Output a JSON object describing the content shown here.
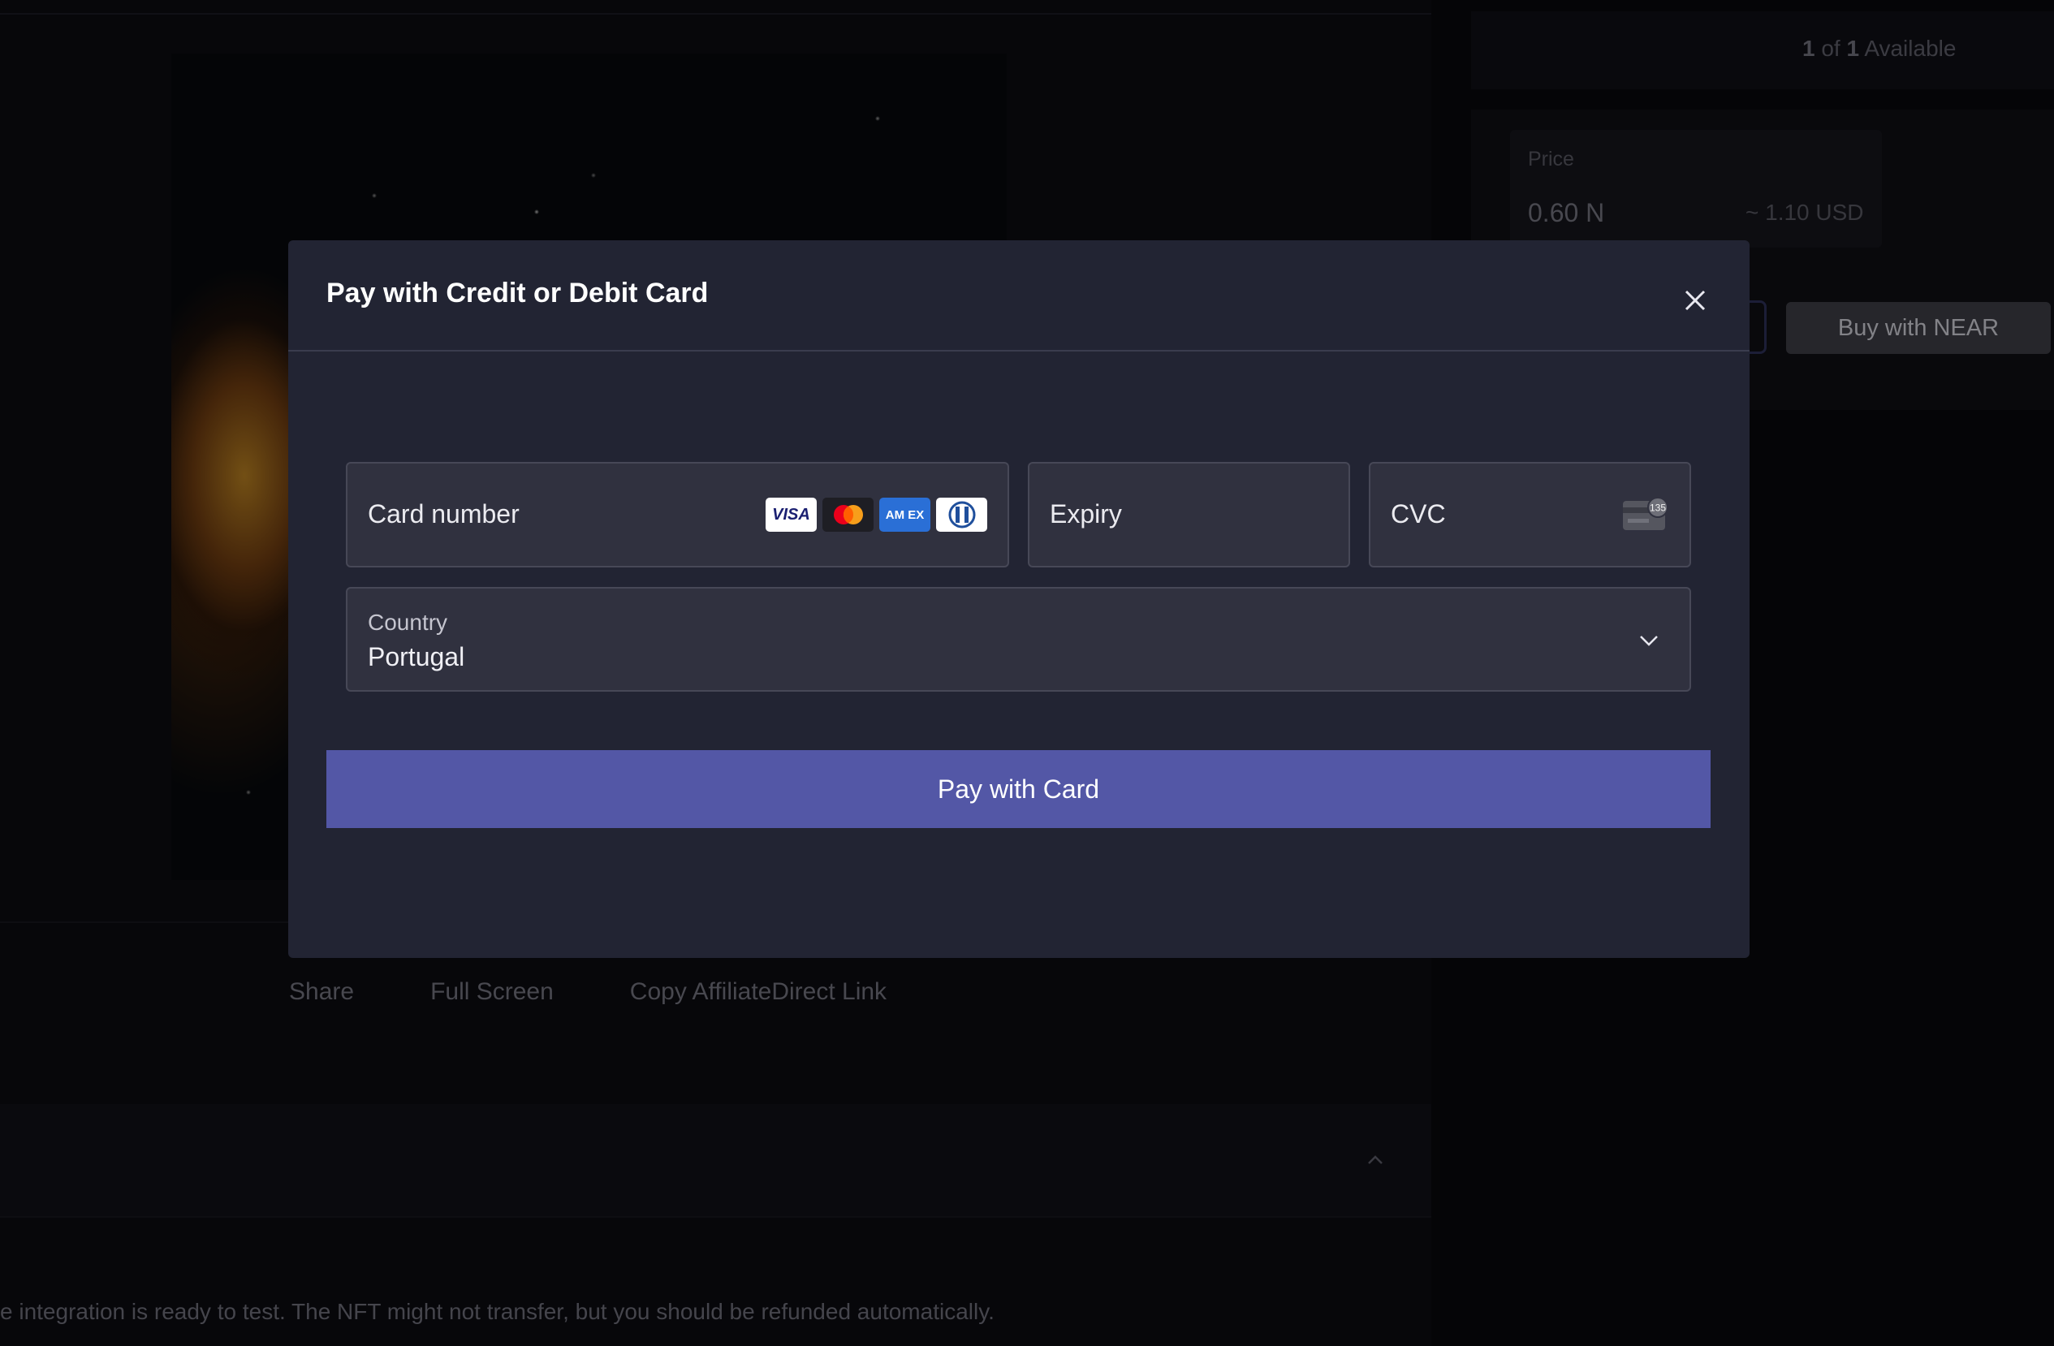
{
  "background": {
    "availability": {
      "count": "1",
      "of": "of",
      "total": "1",
      "label": "Available"
    },
    "price": {
      "label": "Price",
      "value": "0.60 N",
      "usd": "~ 1.10 USD"
    },
    "buy_near_label": "Buy with NEAR",
    "actions": [
      "Share",
      "Full Screen",
      "Copy AffiliateDirect Link"
    ],
    "notice": "e integration is ready to test. The NFT might not transfer, but you should be refunded automatically."
  },
  "modal": {
    "title": "Pay with Credit or Debit Card",
    "card_number_label": "Card number",
    "expiry_label": "Expiry",
    "cvc_label": "CVC",
    "cvc_icon_text": "135",
    "country_label": "Country",
    "country_value": "Portugal",
    "pay_button_label": "Pay with Card",
    "card_brands": [
      "visa",
      "mastercard",
      "amex",
      "diners"
    ],
    "brand_texts": {
      "visa": "VISA",
      "amex": "AM EX"
    }
  },
  "colors": {
    "modal_bg": "#222433",
    "field_bg": "#30313f",
    "pay_button": "#5357a6"
  }
}
